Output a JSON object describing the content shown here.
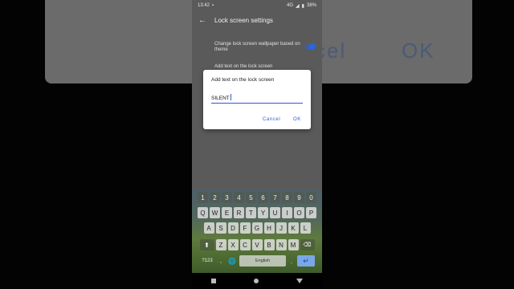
{
  "background": {
    "cancel_text": "cel",
    "ok_text": "OK"
  },
  "status": {
    "time": "13:42",
    "network": "4G",
    "battery": "38%"
  },
  "app_bar": {
    "back_icon": "←",
    "title": "Lock screen settings"
  },
  "settings": {
    "wallpaper_label": "Change lock screen wallpaper based on theme",
    "add_text_label": "Add text on the lock screen"
  },
  "dialog": {
    "title": "Add text on the lock screen",
    "input_value": "SILENT",
    "cancel_label": "Cancel",
    "ok_label": "OK"
  },
  "keyboard": {
    "row1": [
      "1",
      "2",
      "3",
      "4",
      "5",
      "6",
      "7",
      "8",
      "9",
      "0"
    ],
    "row2": [
      "Q",
      "W",
      "E",
      "R",
      "T",
      "Y",
      "U",
      "I",
      "O",
      "P"
    ],
    "row3": [
      "A",
      "S",
      "D",
      "F",
      "G",
      "H",
      "J",
      "K",
      "L"
    ],
    "row4": [
      "Z",
      "X",
      "C",
      "V",
      "B",
      "N",
      "M"
    ],
    "shift": "⬆",
    "backspace": "⌫",
    "sym": "?123",
    "comma": ",",
    "globe": "🌐",
    "space": "English",
    "period": ".",
    "enter": "↵"
  },
  "colors": {
    "accent": "#2a5bd7",
    "enter_key": "#7aa7e8"
  }
}
